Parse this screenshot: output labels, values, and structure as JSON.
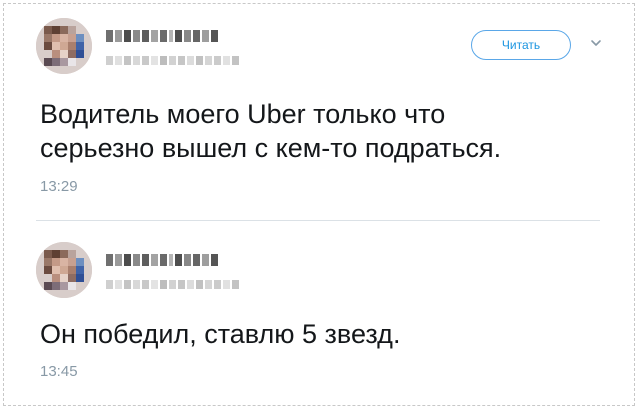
{
  "tweets": [
    {
      "author_name": "",
      "author_handle": "",
      "follow_label": "Читать",
      "text": "Водитель моего Uber только что\nсерьезно вышел с кем-то подраться.",
      "time": "13:29"
    },
    {
      "author_name": "",
      "author_handle": "",
      "text": "Он победил, ставлю 5 звезд.",
      "time": "13:45"
    }
  ],
  "icons": {
    "menu": "chevron-down-icon"
  },
  "colors": {
    "accent": "#1b95e0",
    "text": "#14171a",
    "muted": "#8899a6",
    "divider": "#dbe1e6"
  }
}
